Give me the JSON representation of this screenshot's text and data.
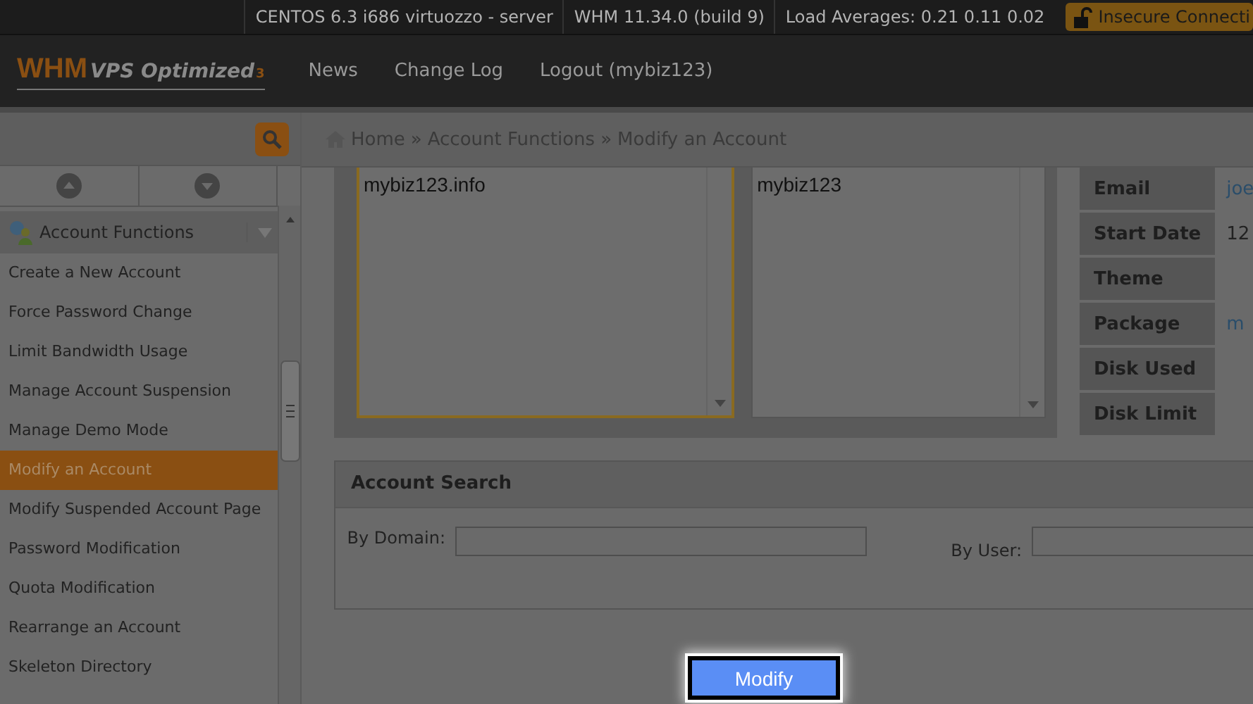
{
  "status_bar": {
    "items": [
      "CENTOS 6.3 i686 virtuozzo - server",
      "WHM 11.34.0 (build 9)",
      "Load Averages: 0.21 0.11 0.02"
    ],
    "security": "Insecure Connecti"
  },
  "header": {
    "logo": "WHM",
    "logo_sub": "VPS Optimized",
    "logo_version": "3",
    "nav": [
      "News",
      "Change Log",
      "Logout (mybiz123)"
    ]
  },
  "sidebar": {
    "group": {
      "label": "Account Functions",
      "expanded": true
    },
    "items": [
      {
        "label": "Create a New Account",
        "selected": false
      },
      {
        "label": "Force Password Change",
        "selected": false
      },
      {
        "label": "Limit Bandwidth Usage",
        "selected": false
      },
      {
        "label": "Manage Account Suspension",
        "selected": false
      },
      {
        "label": "Manage Demo Mode",
        "selected": false
      },
      {
        "label": "Modify an Account",
        "selected": true
      },
      {
        "label": "Modify Suspended Account Page",
        "selected": false
      },
      {
        "label": "Password Modification",
        "selected": false
      },
      {
        "label": "Quota Modification",
        "selected": false
      },
      {
        "label": "Rearrange an Account",
        "selected": false
      },
      {
        "label": "Skeleton Directory",
        "selected": false
      }
    ]
  },
  "breadcrumb": {
    "items": [
      "Home",
      "Account Functions",
      "Modify an Account"
    ],
    "separator": "»"
  },
  "lists": [
    {
      "items": [
        "mybiz123.info"
      ],
      "focused": true
    },
    {
      "items": [
        "mybiz123"
      ],
      "focused": false
    }
  ],
  "details": [
    {
      "label": "Email",
      "value": "joe",
      "kind": "link"
    },
    {
      "label": "Start Date",
      "value": "12",
      "kind": "text"
    },
    {
      "label": "Theme",
      "kind": "text"
    },
    {
      "label": "Package",
      "value": "m",
      "kind": "link"
    },
    {
      "label": "Disk Used",
      "kind": "text"
    },
    {
      "label": "Disk Limit",
      "kind": "text"
    }
  ],
  "account_search": {
    "title": "Account Search",
    "fields": [
      {
        "label": "By Domain:"
      },
      {
        "label": "By User:"
      }
    ]
  },
  "button": "Modify"
}
